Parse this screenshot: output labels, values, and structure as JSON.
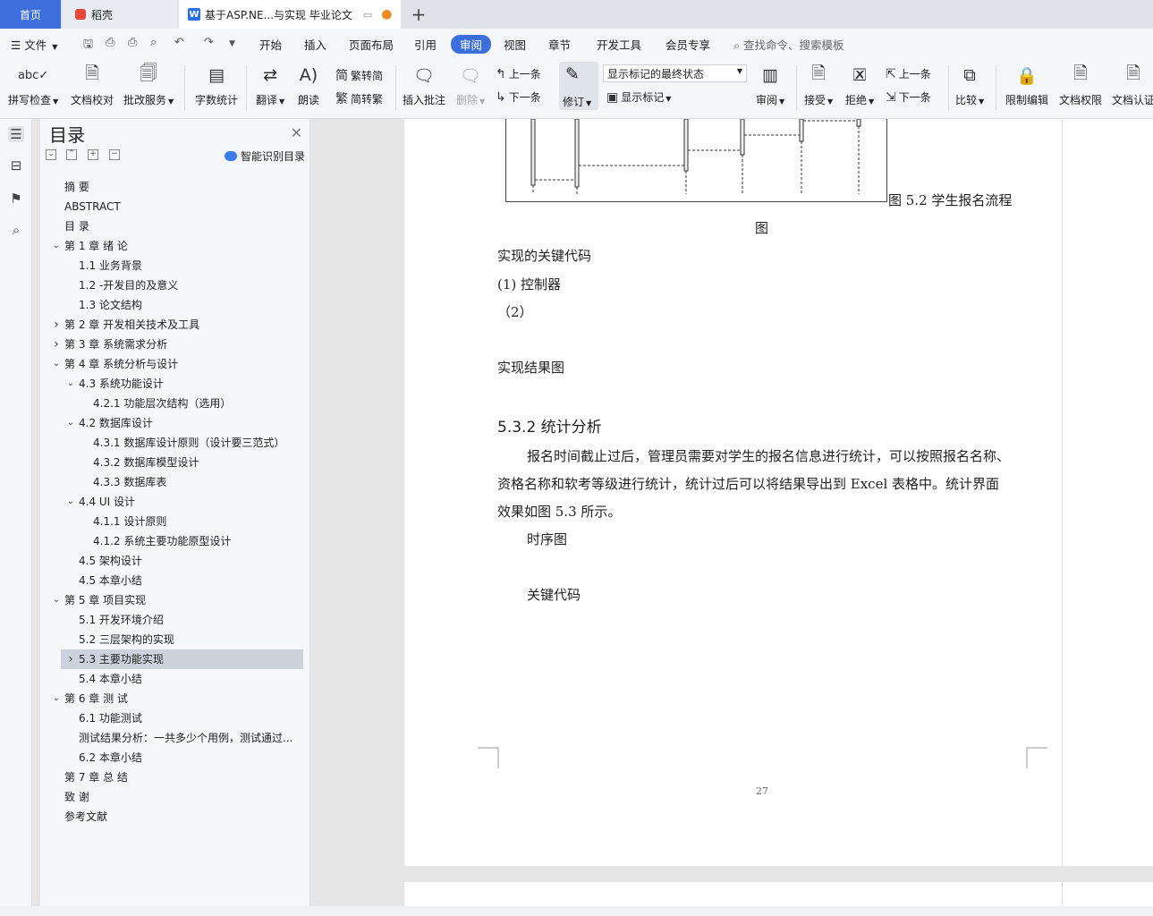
{
  "tabs": {
    "home": "首页",
    "daoke": "稻壳",
    "doc": "基于ASP.NE...与实现 毕业论文",
    "new_tab": "+"
  },
  "menu": {
    "file": "文件",
    "items": [
      "开始",
      "插入",
      "页面布局",
      "引用",
      "审阅",
      "视图",
      "章节",
      "开发工具",
      "会员专享"
    ],
    "active": "审阅",
    "search_placeholder": "查找命令、搜索模板"
  },
  "ribbon": {
    "spell_check": "拼写检查",
    "doc_proof": "文档校对",
    "batch_service": "批改服务",
    "word_count": "字数统计",
    "translate": "翻译",
    "read_aloud": "朗读",
    "to_traditional": "繁转简",
    "to_simplified": "简转繁",
    "insert_comment": "插入批注",
    "delete": "删除",
    "prev_comment": "上一条",
    "next_comment": "下一条",
    "revise": "修订",
    "revision_state": "显示标记的最终状态",
    "show_markup": "显示标记",
    "review": "审阅",
    "accept": "接受",
    "reject": "拒绝",
    "prev_change": "上一条",
    "next_change": "下一条",
    "compare": "比较",
    "restrict_edit": "限制编辑",
    "doc_permission": "文档权限",
    "doc_certify": "文档认证"
  },
  "toc": {
    "title": "目录",
    "smart_identify": "智能识别目录",
    "items": [
      {
        "label": "摘  要",
        "level": 1,
        "arrow": ""
      },
      {
        "label": "ABSTRACT",
        "level": 1,
        "arrow": ""
      },
      {
        "label": "目  录",
        "level": 1,
        "arrow": ""
      },
      {
        "label": "第 1 章  绪  论",
        "level": 1,
        "arrow": "down"
      },
      {
        "label": "1.1  业务背景",
        "level": 2,
        "arrow": ""
      },
      {
        "label": "1.2 -开发目的及意义",
        "level": 2,
        "arrow": ""
      },
      {
        "label": "1.3  论文结构",
        "level": 2,
        "arrow": ""
      },
      {
        "label": "第 2 章  开发相关技术及工具",
        "level": 1,
        "arrow": "right"
      },
      {
        "label": "第 3 章  系统需求分析",
        "level": 1,
        "arrow": "right"
      },
      {
        "label": "第 4 章  系统分析与设计",
        "level": 1,
        "arrow": "down"
      },
      {
        "label": "4.3  系统功能设计",
        "level": 2,
        "arrow": "down"
      },
      {
        "label": "4.2.1  功能层次结构（选用）",
        "level": 3,
        "arrow": ""
      },
      {
        "label": "4.2  数据库设计",
        "level": 2,
        "arrow": "down"
      },
      {
        "label": "4.3.1  数据库设计原则（设计要三范式）",
        "level": 3,
        "arrow": ""
      },
      {
        "label": "4.3.2  数据库模型设计",
        "level": 3,
        "arrow": ""
      },
      {
        "label": "4.3.3  数据库表",
        "level": 3,
        "arrow": ""
      },
      {
        "label": "4.4 UI 设计",
        "level": 2,
        "arrow": "down"
      },
      {
        "label": "4.1.1  设计原则",
        "level": 3,
        "arrow": ""
      },
      {
        "label": "4.1.2  系统主要功能原型设计",
        "level": 3,
        "arrow": ""
      },
      {
        "label": "4.5  架构设计",
        "level": 2,
        "arrow": ""
      },
      {
        "label": "4.5  本章小结",
        "level": 2,
        "arrow": ""
      },
      {
        "label": "第 5 章  项目实现",
        "level": 1,
        "arrow": "down"
      },
      {
        "label": "5.1  开发环境介绍",
        "level": 2,
        "arrow": ""
      },
      {
        "label": "5.2  三层架构的实现",
        "level": 2,
        "arrow": ""
      },
      {
        "label": "5.3  主要功能实现",
        "level": 2,
        "arrow": "right",
        "selected": true
      },
      {
        "label": "5.4  本章小结",
        "level": 2,
        "arrow": ""
      },
      {
        "label": "第 6 章  测  试",
        "level": 1,
        "arrow": "down"
      },
      {
        "label": "6.1  功能测试",
        "level": 2,
        "arrow": ""
      },
      {
        "label": "测试结果分析：一共多少个用例，测试通过...",
        "level": 2,
        "arrow": ""
      },
      {
        "label": "6.2 本章小结",
        "level": 2,
        "arrow": ""
      },
      {
        "label": "第 7 章  总  结",
        "level": 1,
        "arrow": ""
      },
      {
        "label": "致  谢",
        "level": 1,
        "arrow": ""
      },
      {
        "label": "参考文献",
        "level": 1,
        "arrow": ""
      }
    ]
  },
  "document": {
    "figure_caption": "图 5.2  学生报名流程",
    "figure_caption_wrap": "图",
    "key_code": "实现的关键代码",
    "item1": "(1) 控制器",
    "item2": "（2）",
    "result_fig": "实现结果图",
    "section_title": "5.3.2  统计分析",
    "para_line1": "报名时间截止过后，管理员需要对学生的报名信息进行统计，可以按照报名名称、",
    "para_line2": "资格名称和软考等级进行统计，统计过后可以将结果导出到 Excel 表格中。统计界面",
    "para_line3": "效果如图 5.3 所示。",
    "seq_diagram": "时序图",
    "key_code2": "关键代码",
    "page_number": "27"
  },
  "colors": {
    "accent": "#3d6fdc",
    "selection": "#cdd3dc"
  }
}
